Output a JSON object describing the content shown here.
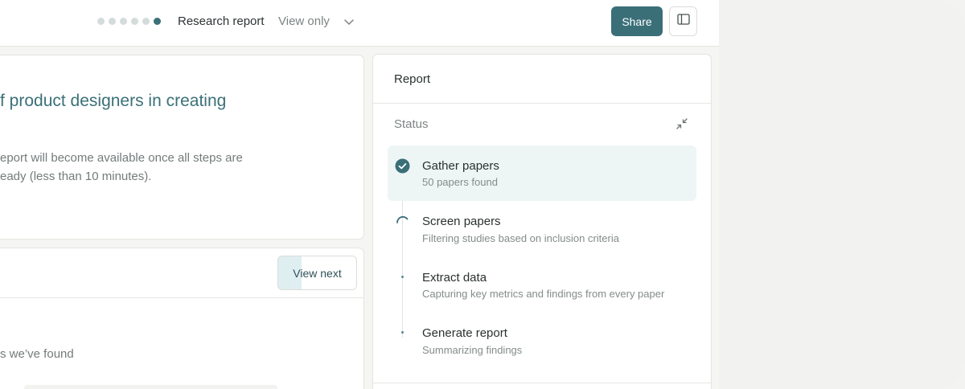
{
  "header": {
    "title": "Research report",
    "access": "View only",
    "share_label": "Share",
    "progress_steps_total": 6,
    "progress_step_active": 6
  },
  "intro": {
    "headline": "f product designers in creating",
    "note_line1": "eport will become available once all steps are",
    "note_line2": "eady (less than 10 minutes)."
  },
  "papers": {
    "view_next_label": "View next",
    "found_text": "s we’ve found"
  },
  "report": {
    "title": "Report",
    "status_label": "Status",
    "steps": [
      {
        "title": "Gather papers",
        "subtitle": "50 papers found",
        "state": "complete"
      },
      {
        "title": "Screen papers",
        "subtitle": "Filtering studies based on inclusion criteria",
        "state": "in-progress"
      },
      {
        "title": "Extract data",
        "subtitle": "Capturing key metrics and findings from every paper",
        "state": "pending"
      },
      {
        "title": "Generate report",
        "subtitle": "Summarizing findings",
        "state": "pending"
      }
    ]
  },
  "colors": {
    "accent": "#3a6f78",
    "active_step_bg": "#eef6f5",
    "view_next_highlight": "#dfeef1"
  },
  "icons": {
    "chevron": "chevron-down-icon",
    "panel": "sidebar-toggle-icon",
    "collapse": "collapse-icon",
    "complete": "check-circle-icon",
    "progress": "spinner-icon"
  }
}
